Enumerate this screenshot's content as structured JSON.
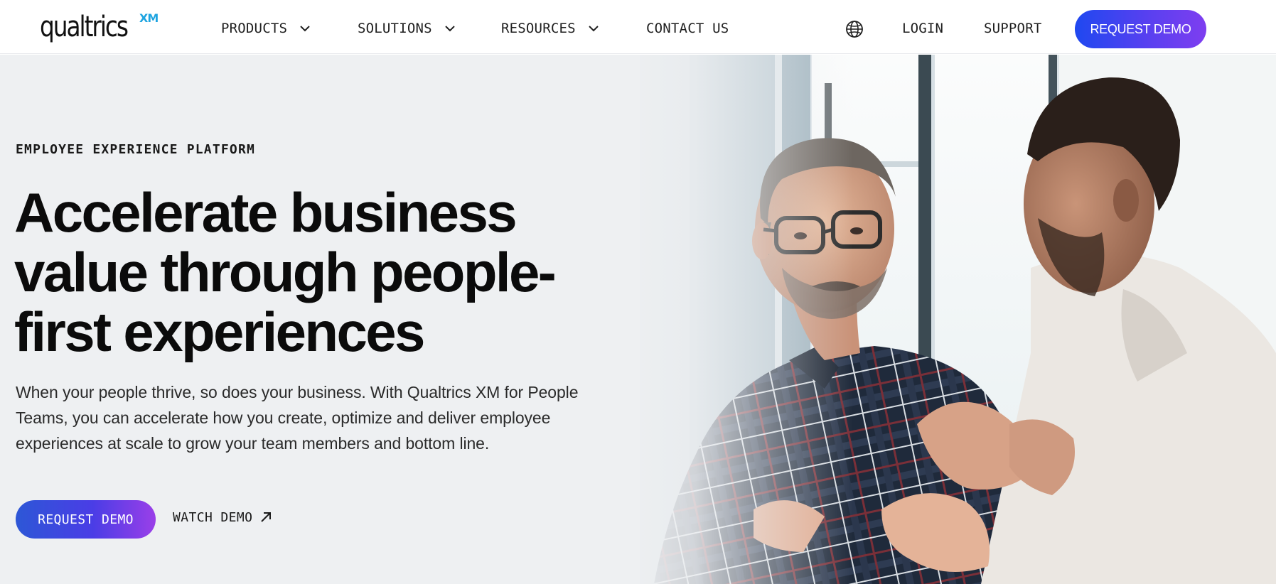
{
  "brand": {
    "wordmark": "qualtrics",
    "badge": "XM",
    "badge_color": "#1ea4e0"
  },
  "nav": {
    "items": [
      {
        "label": "PRODUCTS",
        "has_dropdown": true
      },
      {
        "label": "SOLUTIONS",
        "has_dropdown": true
      },
      {
        "label": "RESOURCES",
        "has_dropdown": true
      },
      {
        "label": "CONTACT US",
        "has_dropdown": false
      }
    ],
    "language_icon": "globe-icon",
    "login": "LOGIN",
    "support": "SUPPORT",
    "cta": "REQUEST DEMO"
  },
  "hero": {
    "eyebrow": "EMPLOYEE EXPERIENCE PLATFORM",
    "headline": "Accelerate business value through people-first experiences",
    "body": "When your people thrive, so does your business. With Qualtrics XM for People Teams, you can accelerate how you create, optimize and deliver employee experiences at scale to grow your team members and bottom line.",
    "primary_cta": "REQUEST DEMO",
    "secondary_cta": "WATCH DEMO",
    "secondary_cta_icon": "arrow-up-right-icon"
  },
  "colors": {
    "cta_gradient_start": "#1f48f0",
    "cta_gradient_end": "#7e3ef0",
    "hero_background": "#eef0f2",
    "text_primary": "#0b0b0b"
  }
}
